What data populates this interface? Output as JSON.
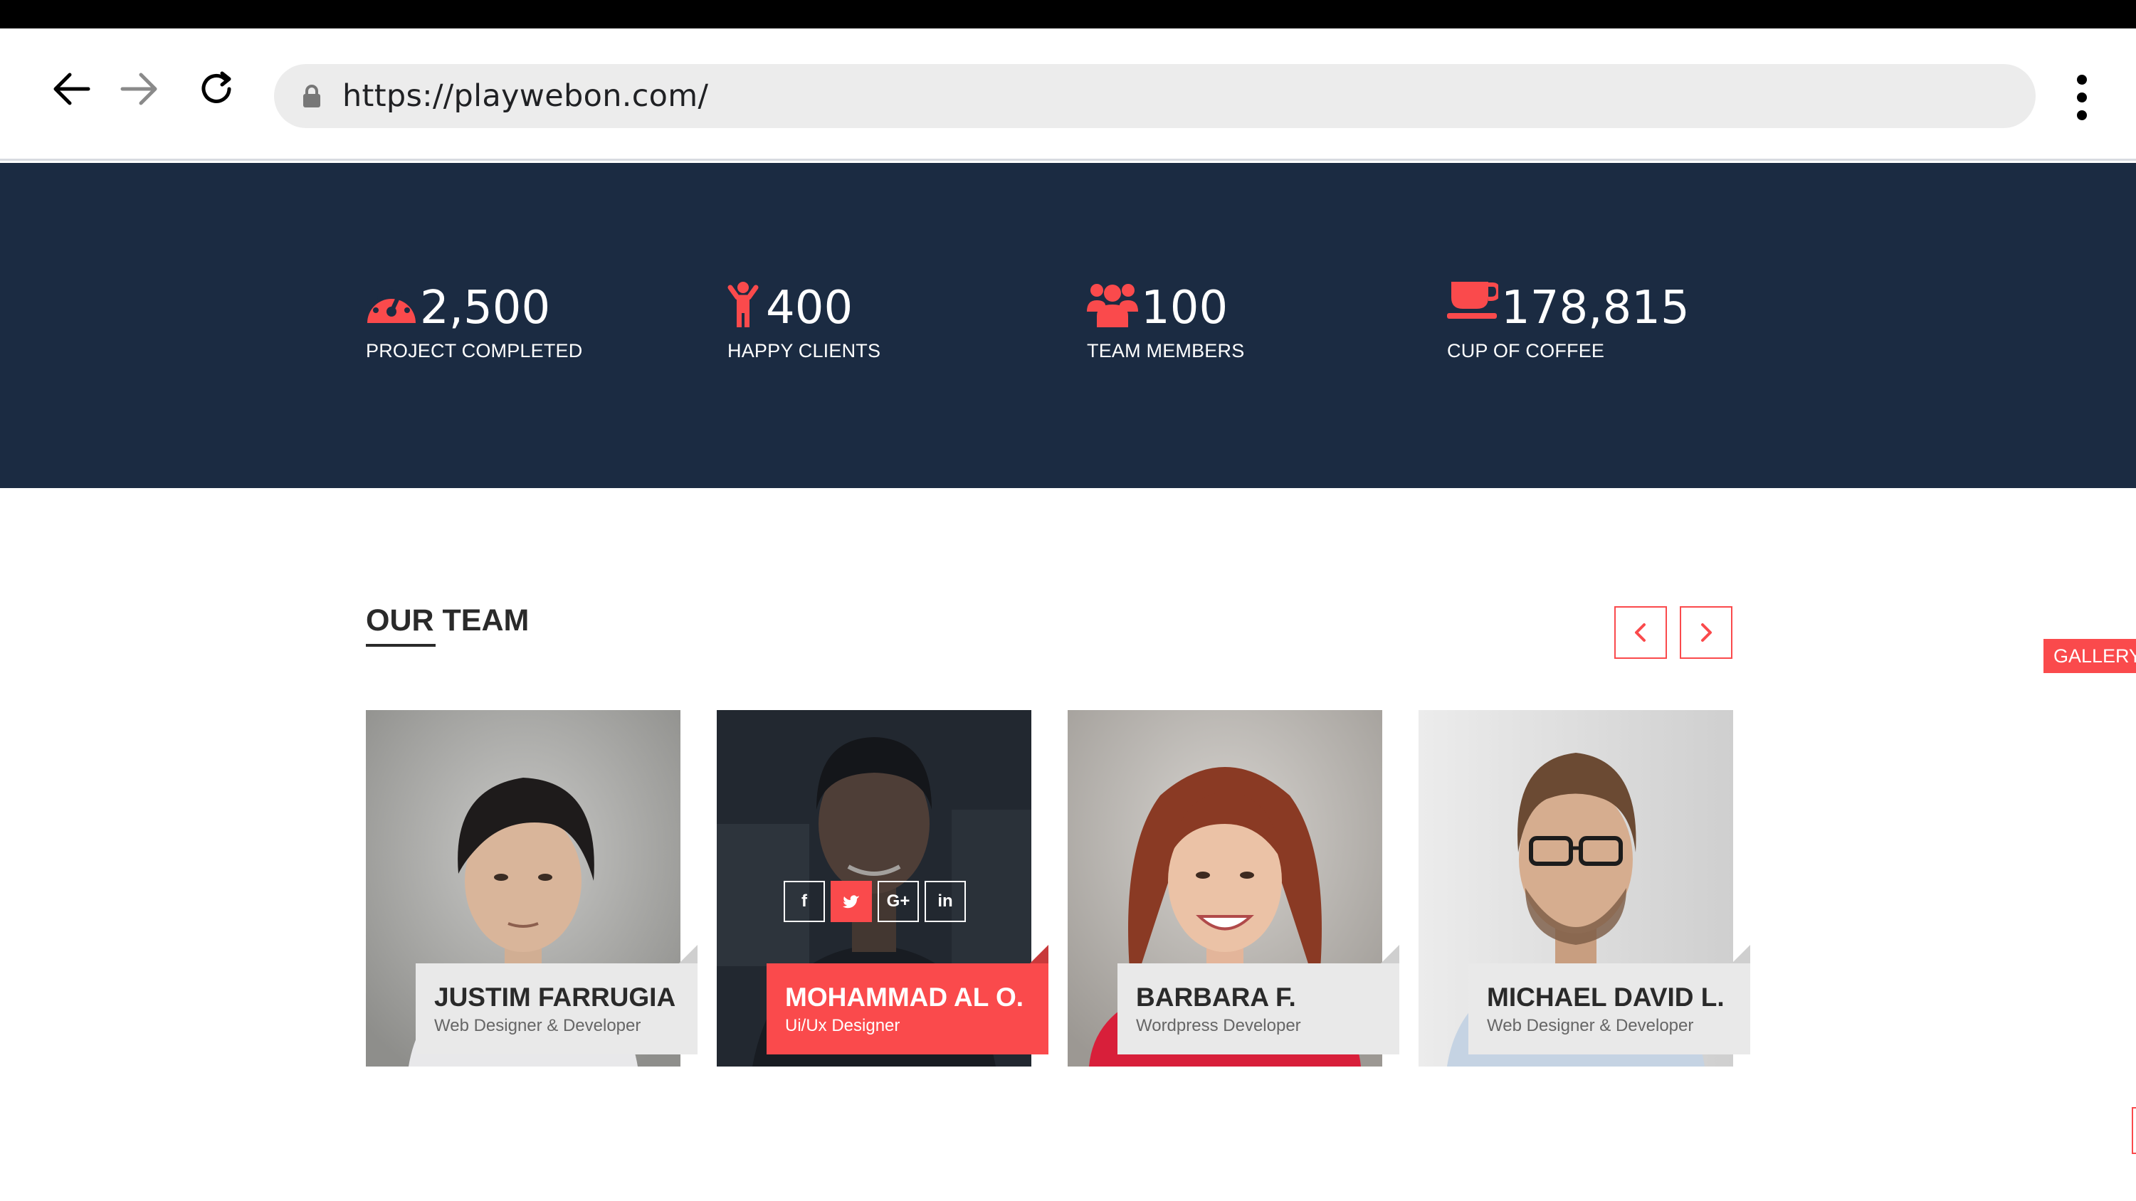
{
  "browser": {
    "url": "https://playwebon.com/",
    "icons": {
      "back": "arrow-left-icon",
      "forward": "arrow-right-icon",
      "reload": "reload-icon",
      "lock": "lock-icon",
      "menu": "more-vertical-icon"
    }
  },
  "stats": [
    {
      "icon": "dashboard-icon",
      "value": "2,500",
      "label": "PROJECT COMPLETED"
    },
    {
      "icon": "child-icon",
      "value": "400",
      "label": "HAPPY CLIENTS"
    },
    {
      "icon": "users-icon",
      "value": "100",
      "label": "TEAM MEMBERS"
    },
    {
      "icon": "coffee-icon",
      "value": "178,815",
      "label": "CUP OF COFFEE"
    }
  ],
  "team": {
    "title": "OUR TEAM",
    "prev_icon": "chevron-left-icon",
    "next_icon": "chevron-right-icon",
    "members": [
      {
        "name": "JUSTIM FARRUGIA",
        "role": "Web Designer & Developer",
        "active": false
      },
      {
        "name": "MOHAMMAD AL O.",
        "role": "Ui/Ux Designer",
        "active": true
      },
      {
        "name": "BARBARA F.",
        "role": "Wordpress Developer",
        "active": false
      },
      {
        "name": "MICHAEL DAVID L.",
        "role": "Web Designer & Developer",
        "active": false
      }
    ],
    "social": [
      "f",
      "t",
      "G+",
      "in"
    ]
  },
  "side_tab": {
    "label": "GALLERY"
  },
  "colors": {
    "accent": "#fa4a4c",
    "stats_bg": "#1b2b42",
    "plate_bg": "#e9e9e9"
  }
}
